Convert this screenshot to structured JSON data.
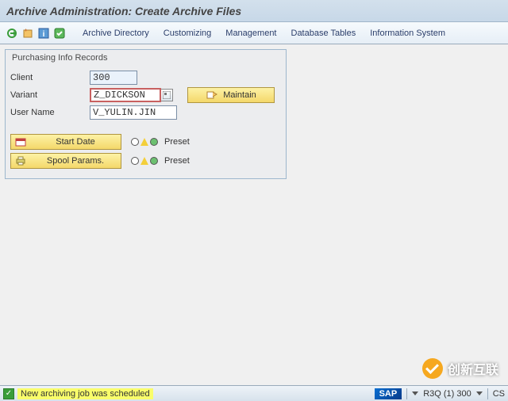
{
  "title": "Archive Administration: Create Archive Files",
  "menu": {
    "archive_directory": "Archive Directory",
    "customizing": "Customizing",
    "management": "Management",
    "database_tables": "Database Tables",
    "information_system": "Information System"
  },
  "group": {
    "title": "Purchasing Info Records",
    "client_label": "Client",
    "client_value": "300",
    "variant_label": "Variant",
    "variant_value": "Z_DICKSON",
    "maintain_label": "Maintain",
    "username_label": "User Name",
    "username_value": "V_YULIN.JIN",
    "start_date_label": "Start Date",
    "spool_params_label": "Spool Params.",
    "preset_label": "Preset"
  },
  "status": {
    "message": "New archiving job was scheduled",
    "system": "R3Q (1) 300",
    "cs": "CS"
  },
  "watermark": "创新互联"
}
